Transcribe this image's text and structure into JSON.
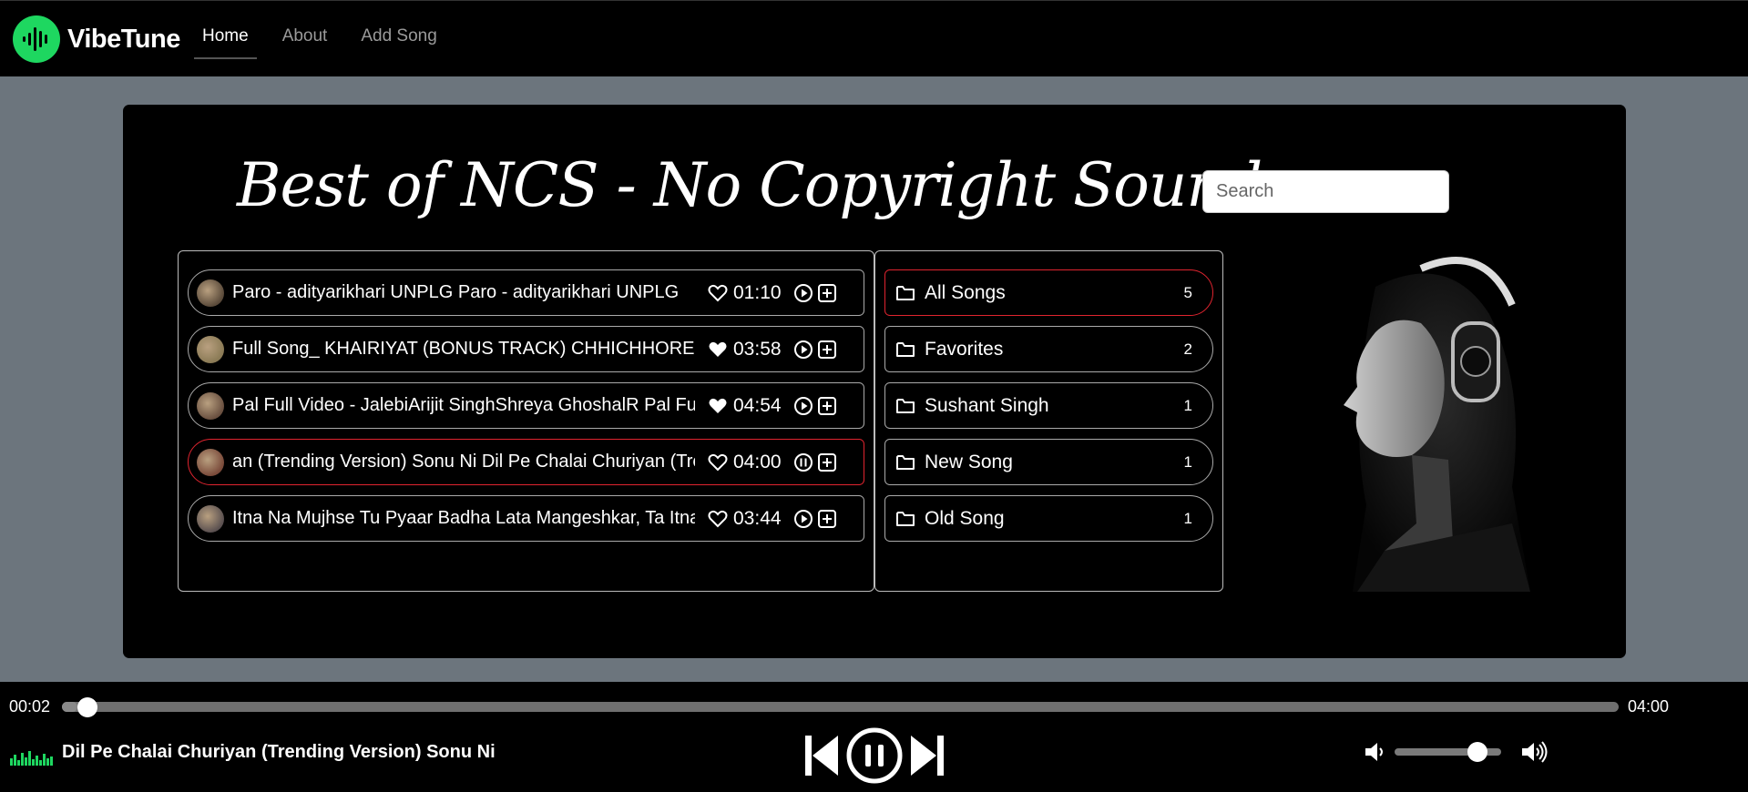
{
  "brand": {
    "name": "VibeTune",
    "accent": "#1ed760"
  },
  "nav": [
    {
      "label": "Home",
      "active": true
    },
    {
      "label": "About",
      "active": false
    },
    {
      "label": "Add Song",
      "active": false
    }
  ],
  "main": {
    "title": "Best of NCS - No Copyright Sounds",
    "search_placeholder": "Search"
  },
  "songs": [
    {
      "title": "Paro - adityarikhari UNPLG   Paro - adityarikhari UNPLG",
      "duration": "01:10",
      "liked": false,
      "playing": false
    },
    {
      "title": "Full Song_ KHAIRIYAT (BONUS TRACK) CHHICHHORE Sushant",
      "duration": "03:58",
      "liked": true,
      "playing": false
    },
    {
      "title": "Pal Full Video - JalebiArijit SinghShreya GhoshalR    Pal Full",
      "duration": "04:54",
      "liked": true,
      "playing": false
    },
    {
      "title": "an (Trending Version) Sonu Ni    Dil Pe Chalai Churiyan (Trending",
      "duration": "04:00",
      "liked": false,
      "playing": true
    },
    {
      "title": "Itna Na Mujhse Tu Pyaar Badha Lata Mangeshkar, Ta    Itna",
      "duration": "03:44",
      "liked": false,
      "playing": false
    }
  ],
  "folders": [
    {
      "name": "All Songs",
      "count": "5",
      "active": true
    },
    {
      "name": "Favorites",
      "count": "2",
      "active": false
    },
    {
      "name": "Sushant Singh",
      "count": "1",
      "active": false
    },
    {
      "name": "New Song",
      "count": "1",
      "active": false
    },
    {
      "name": "Old Song",
      "count": "1",
      "active": false
    }
  ],
  "player": {
    "current_time": "00:02",
    "total_time": "04:00",
    "progress": 0.01,
    "now_playing": "Dil Pe Chalai Churiyan (Trending Version) Sonu Ni",
    "volume": 0.78,
    "state": "playing"
  },
  "icons": {
    "heart_empty": "heart-outline-icon",
    "heart_filled": "heart-filled-icon",
    "play": "play-circle-icon",
    "pause": "pause-circle-icon",
    "add": "plus-square-icon",
    "folder": "folder-icon"
  }
}
